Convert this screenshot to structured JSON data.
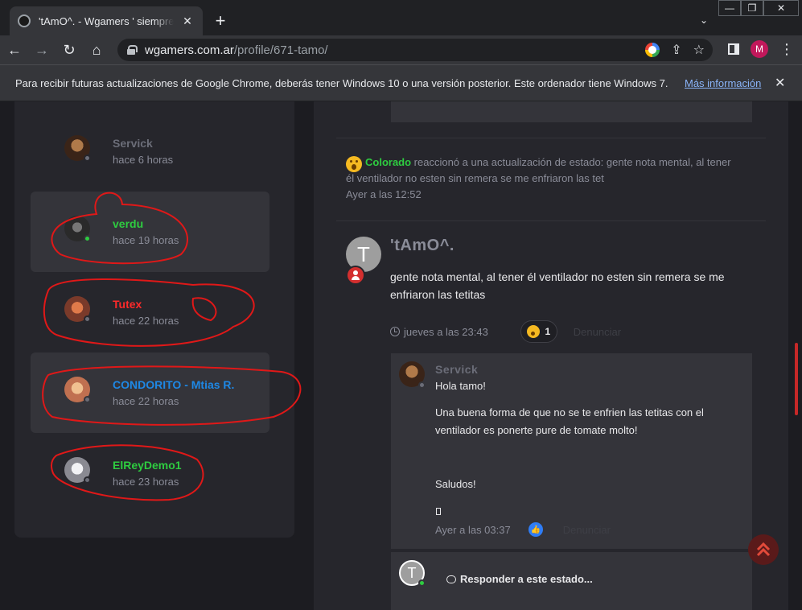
{
  "browser": {
    "tab_title": "'tAmO^. - Wgamers ' siempre un",
    "tab_close": "✕",
    "new_tab": "+",
    "tab_search": "⌄",
    "window_controls": {
      "minimize": "—",
      "maximize": "❐",
      "close": "✕"
    },
    "nav": {
      "back": "←",
      "forward": "→",
      "reload": "↻",
      "home": "⌂"
    },
    "url_host": "wgamers.com.ar",
    "url_path": "/profile/671-tamo/",
    "omnibox_icons": {
      "share": "⇪",
      "bookmark": "☆"
    },
    "profile_initial": "M",
    "menu": "⋮"
  },
  "infobar": {
    "text": "Para recibir futuras actualizaciones de Google Chrome, deberás tener Windows 10 o una versión posterior. Este ordenador tiene Windows 7.",
    "link": "Más información",
    "close": "✕"
  },
  "members": [
    {
      "name": "Servick",
      "time": "hace 6 horas",
      "name_color": "#6b6d78",
      "online": false,
      "highlight": false,
      "avatar_color": "#5a3a2a"
    },
    {
      "name": "verdu",
      "time": "hace 19 horas",
      "name_color": "#2ecc40",
      "online": true,
      "highlight": true,
      "avatar_color": "#3a3a3a"
    },
    {
      "name": "Tutex",
      "time": "hace 22 horas",
      "name_color": "#ff2a2a",
      "online": false,
      "highlight": false,
      "avatar_color": "#c0583a"
    },
    {
      "name": "CONDORITO - Mtias R.",
      "time": "hace 22 horas",
      "name_color": "#1e88e5",
      "online": false,
      "highlight": true,
      "avatar_color": "#d89b6a"
    },
    {
      "name": "ElReyDemo1",
      "time": "hace 23 horas",
      "name_color": "#2ecc40",
      "online": false,
      "highlight": false,
      "avatar_color": "#d9d9e0"
    }
  ],
  "activity": {
    "user": "Colorado",
    "text": " reaccionó a una actualización de estado: gente nota mental, al tener él ventilador no esten sin remera se me enfriaron las tet",
    "time": "Ayer a las 12:52"
  },
  "post": {
    "avatar_initial": "T",
    "author": "'tAmO^.",
    "text": "gente nota mental, al tener él ventilador no esten sin remera se me enfriaron las tetitas",
    "time": "jueves a las 23:43",
    "reaction_count": "1",
    "report": "Denunciar"
  },
  "comment": {
    "author": "Servick",
    "line1": "Hola tamo!",
    "line2": "Una buena forma de que no se te enfrien las tetitas con el ventilador es ponerte pure de tomate molto!",
    "line3": "Saludos!",
    "time": "Ayer a las 03:37",
    "like_glyph": "👍",
    "report": "Denunciar"
  },
  "reply": {
    "avatar_initial": "T",
    "placeholder": "Responder a este estado..."
  },
  "colors": {
    "accent_green": "#2ecc40",
    "annotation_red": "#e01818",
    "link_blue": "#8ab4f8"
  }
}
